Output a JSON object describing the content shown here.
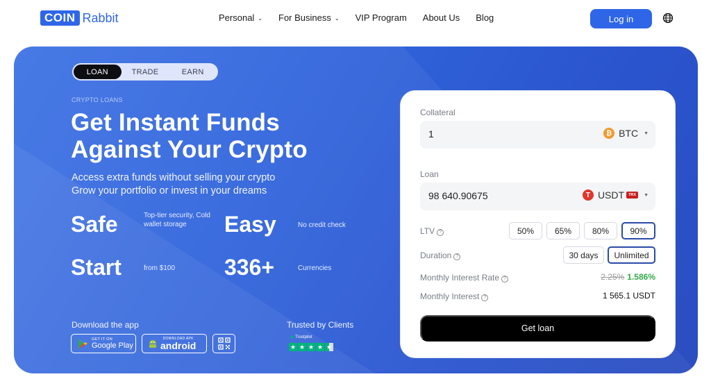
{
  "header": {
    "logo_box": "COIN",
    "logo_word": "Rabbit",
    "nav": [
      {
        "label": "Personal",
        "dropdown": true
      },
      {
        "label": "For Business",
        "dropdown": true
      },
      {
        "label": "VIP Program",
        "dropdown": false
      },
      {
        "label": "About Us",
        "dropdown": false
      },
      {
        "label": "Blog",
        "dropdown": false
      }
    ],
    "login_label": "Log in",
    "globe_icon": "globe-icon"
  },
  "hero": {
    "tabs": [
      "LOAN",
      "TRADE",
      "EARN"
    ],
    "active_tab": "LOAN",
    "eyebrow": "CRYPTO LOANS",
    "title_line1": "Get Instant Funds",
    "title_line2": "Against Your Crypto",
    "sub_line1": "Access extra funds without selling your crypto",
    "sub_line2": "Grow your portfolio or invest in your dreams",
    "stats": [
      {
        "big": "Safe",
        "small": "Top-tier security, Cold wallet storage"
      },
      {
        "big": "Easy",
        "small": "No credit check"
      },
      {
        "big": "Start",
        "small": "from $100"
      },
      {
        "big": "336+",
        "small": "Currencies"
      }
    ],
    "download_label": "Download the app",
    "google_play_small": "GET IT ON",
    "google_play_big": "Google Play",
    "apk_small": "DOWNLOAD APK",
    "apk_big": "android",
    "trusted_label": "Trusted by Clients",
    "trustpilot_name": "Trustpilot",
    "trustpilot_rating": 4.5,
    "colors": {
      "hero": "#3266dd",
      "accent": "#2f66e8",
      "trustpilot": "#00b67a"
    }
  },
  "card": {
    "collateral_label": "Collateral",
    "collateral_value": "1",
    "collateral_currency": "BTC",
    "loan_label": "Loan",
    "loan_value": "98 640.90675",
    "loan_currency": "USDT",
    "loan_network": "TRX",
    "ltv_label": "LTV",
    "ltv_options": [
      "50%",
      "65%",
      "80%",
      "90%"
    ],
    "ltv_selected": "90%",
    "duration_label": "Duration",
    "duration_options": [
      "30 days",
      "Unlimited"
    ],
    "duration_selected": "Unlimited",
    "rate_label": "Monthly Interest Rate",
    "rate_old": "2.25%",
    "rate_new": "1.586%",
    "interest_label": "Monthly Interest",
    "interest_value": "1 565.1 USDT",
    "cta_label": "Get loan"
  }
}
